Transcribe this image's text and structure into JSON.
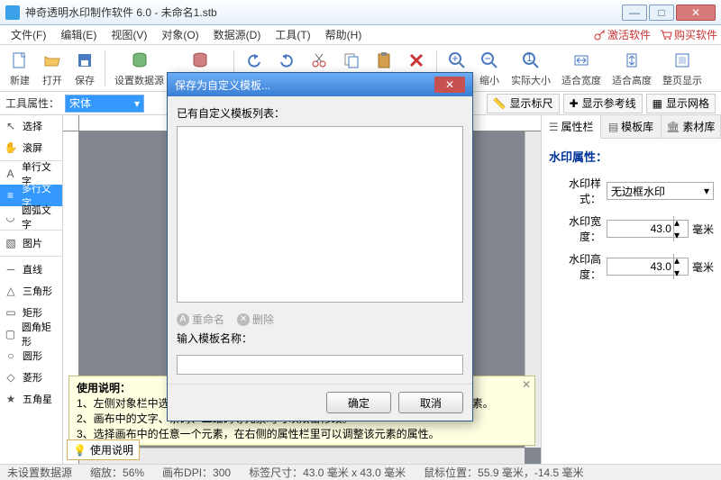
{
  "title": "神奇透明水印制作软件 6.0 - 未命名1.stb",
  "menu": [
    "文件(F)",
    "编辑(E)",
    "视图(V)",
    "对象(O)",
    "数据源(D)",
    "工具(T)",
    "帮助(H)"
  ],
  "rlinks": {
    "activate": "激活软件",
    "buy": "购买软件"
  },
  "toolbar": [
    "新建",
    "打开",
    "保存",
    "设置数据源",
    "移除数据源",
    "撤销",
    "恢复",
    "剪切",
    "复制",
    "粘贴",
    "删除",
    "放大",
    "缩小",
    "实际大小",
    "适合宽度",
    "适合高度",
    "整页显示"
  ],
  "secondbar": {
    "label": "工具属性：",
    "value": "宋体",
    "rbtns": {
      "ruler": "显示标尺",
      "guides": "显示参考线",
      "grid": "显示网格"
    }
  },
  "tools": [
    "选择",
    "滚屏",
    "|",
    "单行文字",
    "多行文字",
    "圆弧文字",
    "|",
    "图片",
    "|",
    "直线",
    "三角形",
    "矩形",
    "圆角矩形",
    "圆形",
    "菱形",
    "五角星"
  ],
  "selected_tool_idx": 4,
  "panel": {
    "tabs": [
      "属性栏",
      "模板库",
      "素材库"
    ],
    "title": "水印属性：",
    "rows": {
      "style_label": "水印样式：",
      "style_value": "无边框水印",
      "width_label": "水印宽度：",
      "width_value": "43.0",
      "width_unit": "毫米",
      "height_label": "水印高度：",
      "height_value": "43.0",
      "height_unit": "毫米"
    }
  },
  "help": {
    "title": "使用说明：",
    "l1": "1、左侧对象栏中选择一个工具后，在画布区域按住鼠标左键拖动，即可添加一个元素。",
    "l2": "2、画布中的文字、条码、二维码等元素均可以双击修改。",
    "l3": "3、选择画布中的任意一个元素，在右侧的属性栏里可以调整该元素的属性。",
    "tag": "使用说明"
  },
  "status": {
    "src": "未设置数据源",
    "zoom": "缩放：56%",
    "dpi": "画布DPI：300",
    "size": "标签尺寸：43.0 毫米 x 43.0 毫米",
    "pos": "鼠标位置：55.9 毫米，-14.5 毫米"
  },
  "modal": {
    "title": "保存为自定义模板...",
    "list_label": "已有自定义模板列表：",
    "rename": "重命名",
    "delete": "删除",
    "input_label": "输入模板名称：",
    "input_value": "",
    "ok": "确定",
    "cancel": "取消"
  }
}
